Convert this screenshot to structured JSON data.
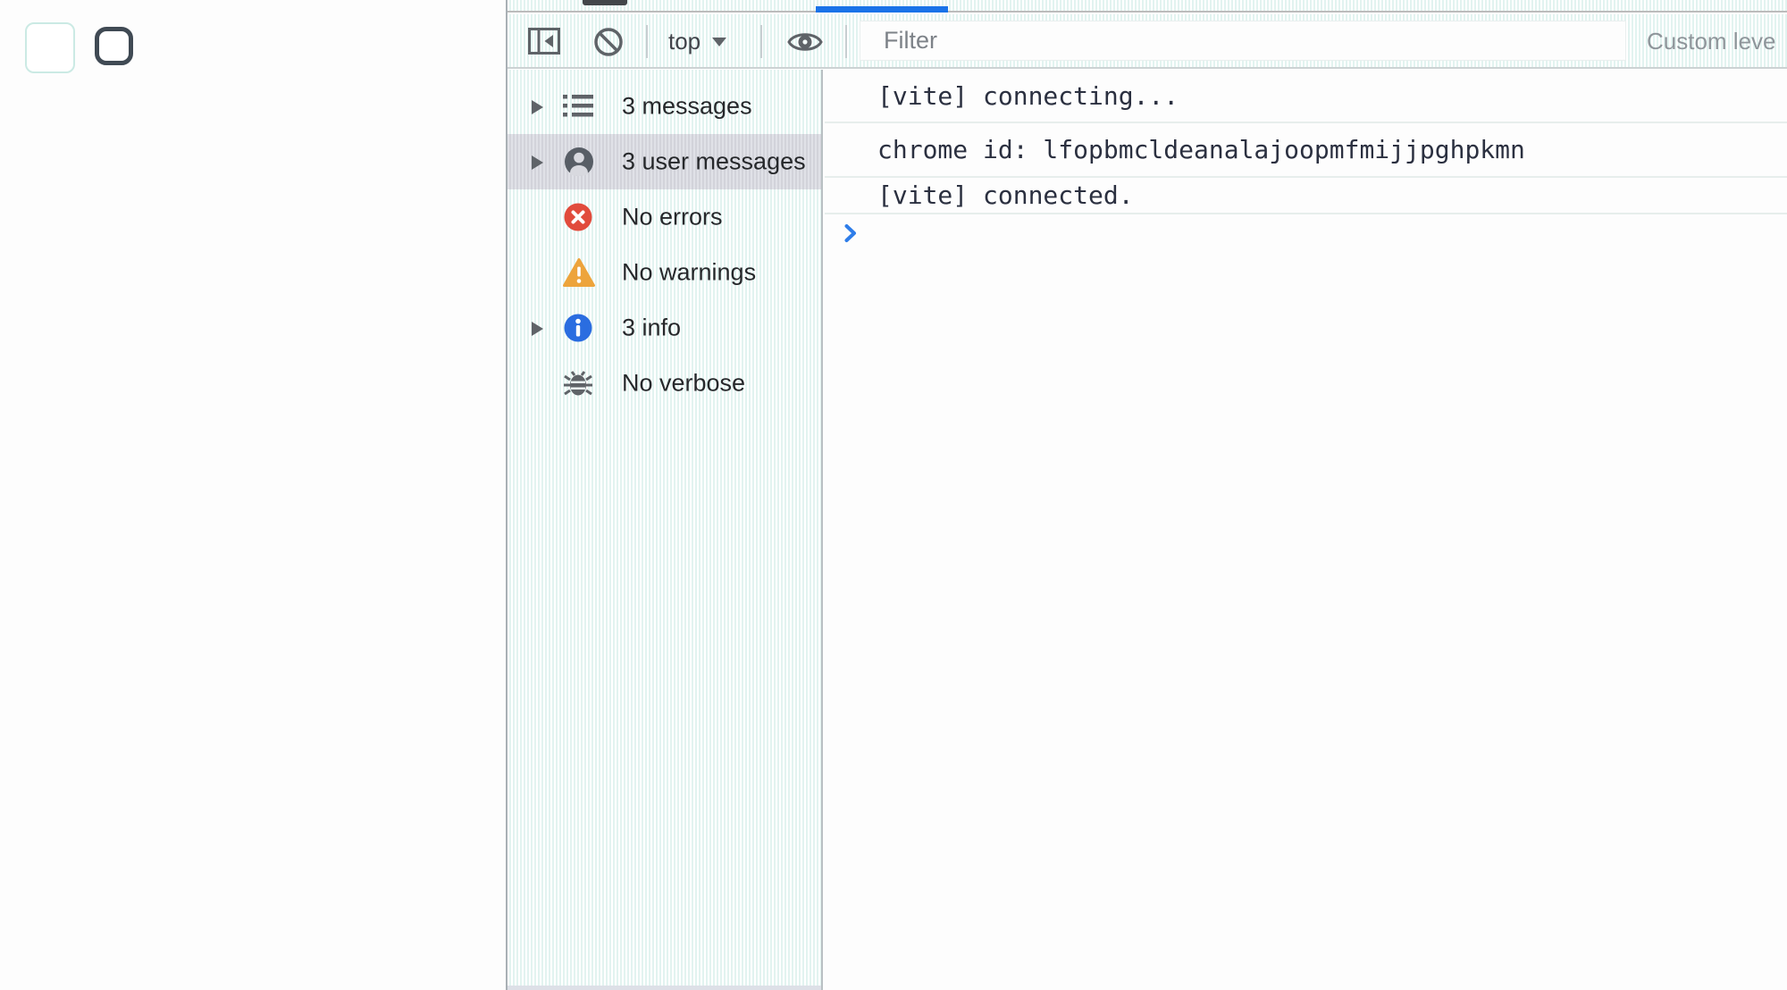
{
  "left_page": {
    "checkbox_count": 2
  },
  "devtools": {
    "toolbar": {
      "context_selector_value": "top",
      "filter_placeholder": "Filter",
      "filter_value": "",
      "custom_levels_label": "Custom leve"
    },
    "sidebar": {
      "items": [
        {
          "label": "3 messages",
          "icon": "list-icon",
          "expandable": true,
          "selected": false
        },
        {
          "label": "3 user messages",
          "icon": "user-icon",
          "expandable": true,
          "selected": true
        },
        {
          "label": "No errors",
          "icon": "error-icon",
          "expandable": false,
          "selected": false
        },
        {
          "label": "No warnings",
          "icon": "warning-icon",
          "expandable": false,
          "selected": false
        },
        {
          "label": "3 info",
          "icon": "info-icon",
          "expandable": true,
          "selected": false
        },
        {
          "label": "No verbose",
          "icon": "bug-icon",
          "expandable": false,
          "selected": false
        }
      ]
    },
    "console": {
      "messages": [
        {
          "text": "[vite] connecting..."
        },
        {
          "text": "chrome id: lfopbmcldeanalajoopmfmijjpghpkmn"
        },
        {
          "text": "[vite] connected."
        }
      ],
      "prompt_symbol": ">"
    },
    "colors": {
      "accent_blue": "#1a73e8",
      "prompt_blue": "#2e7de9",
      "info_blue": "#2a6de0",
      "error_red": "#e14b3c",
      "warning_amber": "#eda43c",
      "icon_gray": "#5f6368",
      "selected_row_bg": "#d7d8de",
      "checkbox1_border": "#cbeae4",
      "checkbox2_border": "#404a54"
    }
  }
}
